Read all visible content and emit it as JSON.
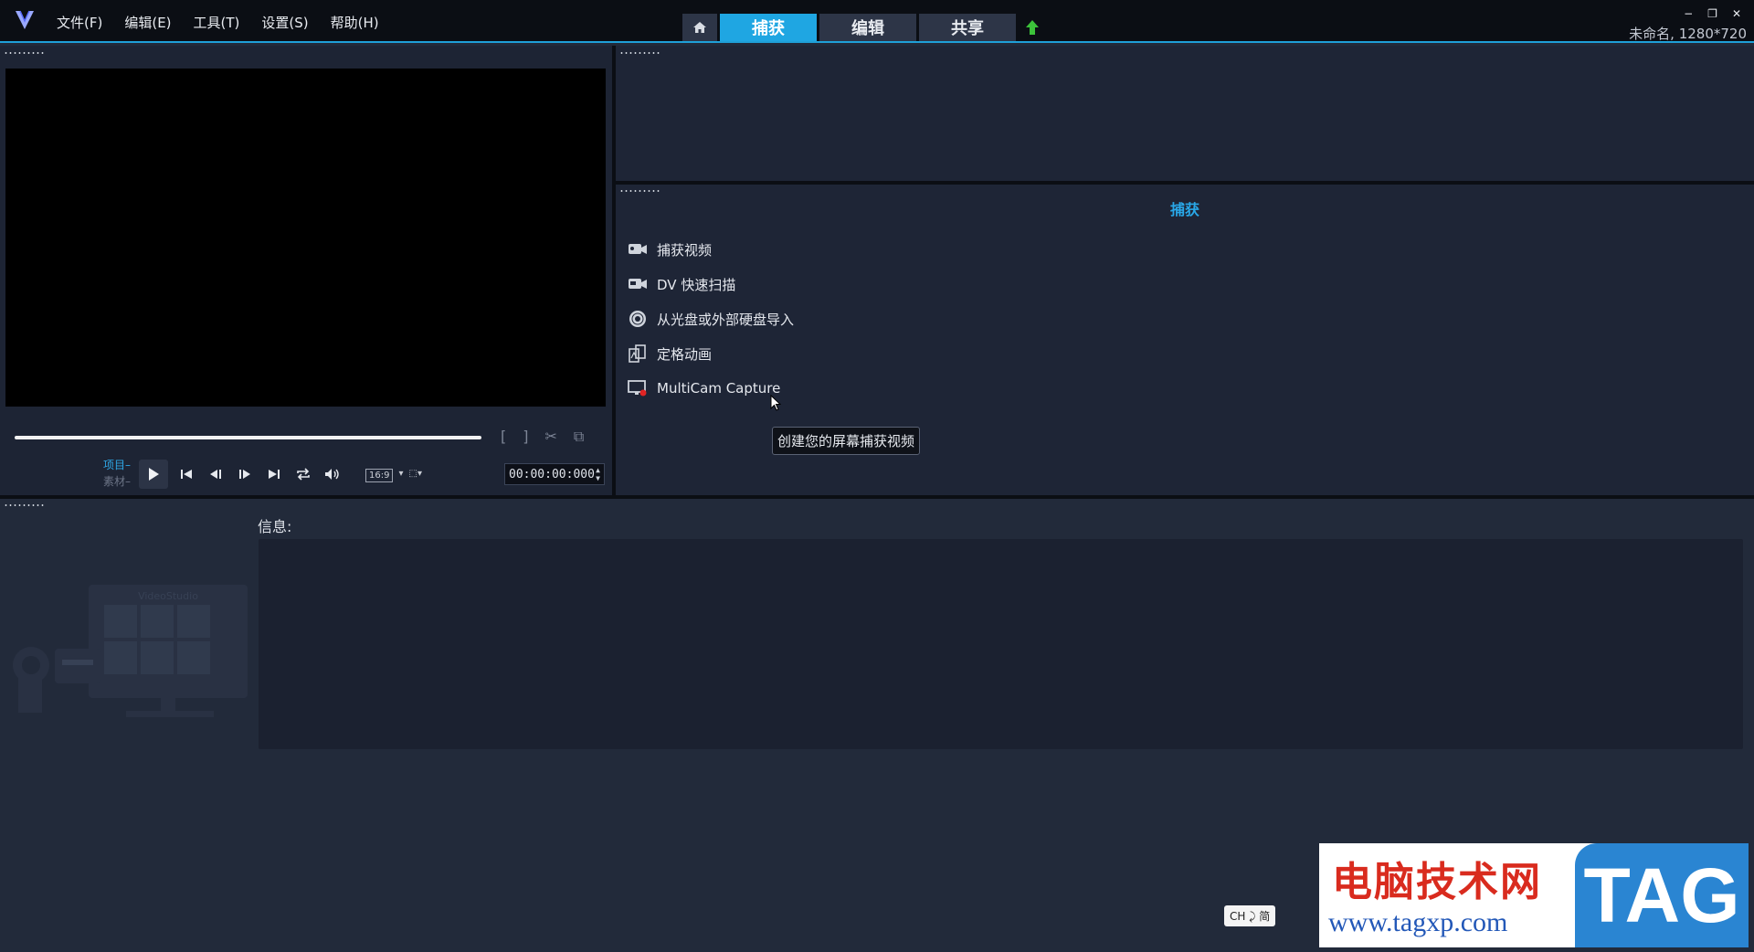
{
  "menu": [
    "文件(F)",
    "编辑(E)",
    "工具(T)",
    "设置(S)",
    "帮助(H)"
  ],
  "tabs": {
    "capture": "捕获",
    "edit": "编辑",
    "share": "共享"
  },
  "window": {
    "project_info": "未命名, 1280*720",
    "minimize": "−",
    "restore": "❐",
    "close": "✕"
  },
  "player": {
    "mode_project": "项目",
    "mode_clip": "素材",
    "aspect": "16:9",
    "timecode": "00:00:00:000"
  },
  "capture": {
    "title": "捕获",
    "items": [
      {
        "label": "捕获视频",
        "icon": "video-capture-icon"
      },
      {
        "label": "DV 快速扫描",
        "icon": "dv-scan-icon"
      },
      {
        "label": "从光盘或外部硬盘导入",
        "icon": "disc-import-icon"
      },
      {
        "label": "定格动画",
        "icon": "stop-motion-icon"
      },
      {
        "label": "MultiCam Capture",
        "icon": "screen-capture-icon"
      }
    ],
    "tooltip": "创建您的屏幕捕获视频"
  },
  "info": {
    "label": "信息:"
  },
  "illustration_text": "VideoStudio",
  "ime": "CH ⤸ 简",
  "watermark": {
    "cn": "电脑技术网",
    "url": "www.tagxp.com",
    "tag": "TAG"
  },
  "colors": {
    "accent": "#1fa6e2",
    "background": "#222a3a",
    "panel": "#1e2536"
  }
}
